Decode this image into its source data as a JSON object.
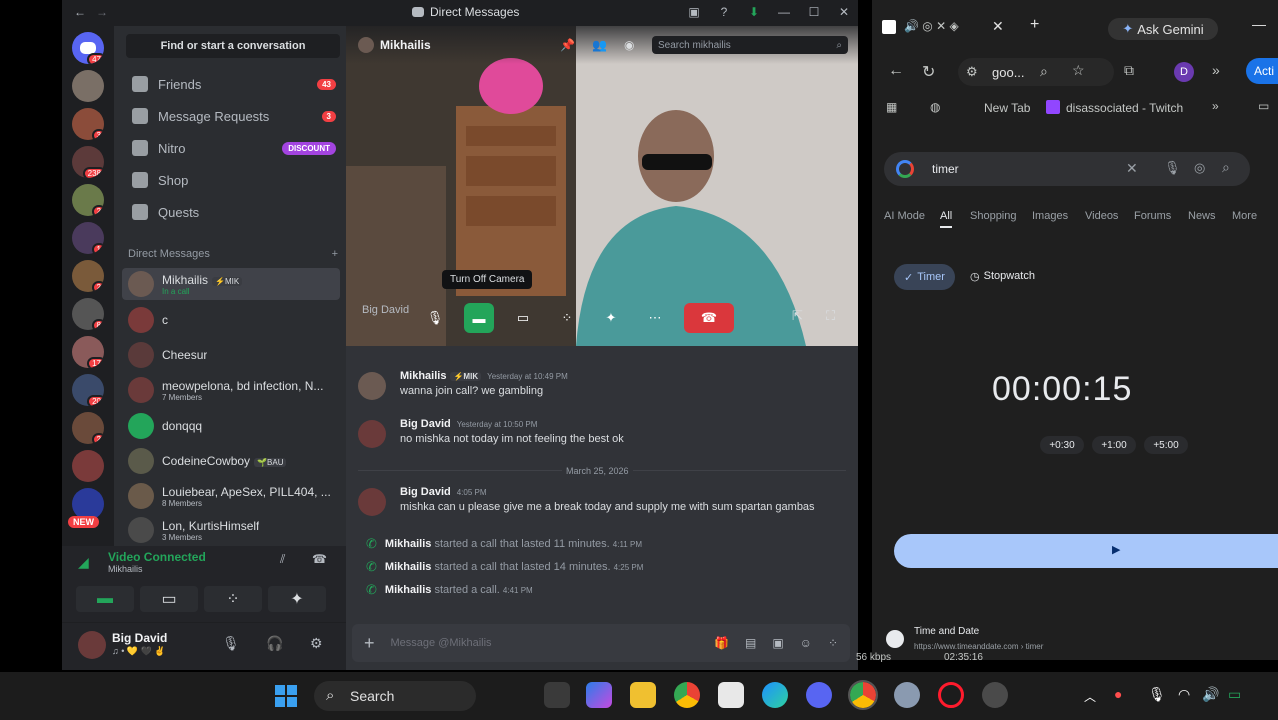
{
  "discord": {
    "window_title": "Direct Messages",
    "find_placeholder": "Find or start a conversation",
    "nav": [
      {
        "label": "Friends",
        "count": "43"
      },
      {
        "label": "Message Requests",
        "count": "3"
      },
      {
        "label": "Nitro",
        "badge": "DISCOUNT"
      },
      {
        "label": "Shop"
      },
      {
        "label": "Quests"
      }
    ],
    "dm_header": "Direct Messages",
    "dms": [
      {
        "name": "Mikhailis",
        "tag": "⚡MIK",
        "sub": "In a call"
      },
      {
        "name": "c"
      },
      {
        "name": "Cheesur"
      },
      {
        "name": "meowpelona, bd infection, N...",
        "sub": "7 Members"
      },
      {
        "name": "donqqq"
      },
      {
        "name": "CodeineCowboy",
        "tag": "🌱BAU"
      },
      {
        "name": "Louiebear, ApeSex, PILL404, ...",
        "sub": "8 Members"
      },
      {
        "name": "Lon, KurtisHimself",
        "sub": "3 Members"
      }
    ],
    "server_badges": [
      "47",
      "3",
      "238",
      "2",
      "1",
      "2",
      "8",
      "17",
      "20",
      "2"
    ],
    "new_badge": "NEW",
    "voice": {
      "status": "Video Connected",
      "channel": "Mikhailis"
    },
    "user": {
      "name": "Big David",
      "status": "♫ • 💛 🖤 ✌"
    },
    "chat": {
      "channel_name": "Mikhailis",
      "search_placeholder": "Search mikhailis",
      "tooltip": "Turn Off Camera",
      "video_label": "Big David",
      "messages": [
        {
          "author": "Mikhailis",
          "tag": "⚡MIK",
          "time": "Yesterday at 10:49 PM",
          "text": "wanna join call? we gambling"
        },
        {
          "author": "Big David",
          "time": "Yesterday at 10:50 PM",
          "text": "no mishka not today im not feeling the best ok"
        },
        {
          "author": "Big David",
          "time": "4:05 PM",
          "text": "mishka can u please give me a break today and supply me with sum spartan gambas"
        }
      ],
      "date_divider": "March 25, 2026",
      "system": [
        {
          "author": "Mikhailis",
          "text": "started a call that lasted 11 minutes.",
          "time": "4:11 PM"
        },
        {
          "author": "Mikhailis",
          "text": "started a call that lasted 14 minutes.",
          "time": "4:25 PM"
        },
        {
          "author": "Mikhailis",
          "text": "started a call.",
          "time": "4:41 PM"
        }
      ],
      "composer_placeholder": "Message @Mikhailis"
    }
  },
  "browser": {
    "ask_gemini": "Ask Gemini",
    "address": "goo...",
    "action_btn": "Acti",
    "bookmarks": [
      "New Tab",
      "disassociated - Twitch"
    ],
    "search_query": "timer",
    "serp_tabs": [
      "AI Mode",
      "All",
      "Shopping",
      "Images",
      "Videos",
      "Forums",
      "News",
      "More"
    ],
    "timer_tabs": [
      "Timer",
      "Stopwatch"
    ],
    "timer_value": "00:00:15",
    "adjust": [
      "+0:30",
      "+1:00",
      "+5:00"
    ],
    "result_title": "Time and Date",
    "result_url": "https://www.timeanddate.com › timer",
    "overlay_kbps": "56 kbps",
    "overlay_time": "02:35:16"
  },
  "taskbar": {
    "search_label": "Search"
  },
  "colors": {
    "discord_bg": "#313338",
    "end_call": "#da373c",
    "accent": "#5865f2",
    "green": "#23a55a",
    "timer_start": "#a8c7fa"
  }
}
